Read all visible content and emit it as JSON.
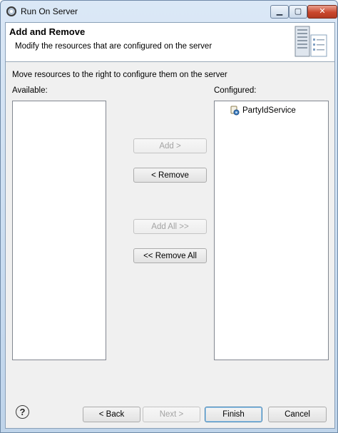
{
  "window": {
    "title": "Run On Server",
    "controls": {
      "minimize": "▁",
      "maximize": "▢",
      "close": "✕"
    }
  },
  "banner": {
    "title": "Add and Remove",
    "description": "Modify the resources that are configured on the server",
    "image_icon": "server-icon"
  },
  "body": {
    "instruction": "Move resources to the right to configure them on the server",
    "available_label": "Available:",
    "configured_label": "Configured:",
    "available_items": [],
    "configured_items": [
      {
        "label": "PartyIdService",
        "icon": "service-module-icon"
      }
    ]
  },
  "transfer_buttons": {
    "add": "Add >",
    "remove": "< Remove",
    "add_all": "Add All >>",
    "remove_all": "<< Remove All"
  },
  "footer": {
    "help": "?",
    "back": "< Back",
    "next": "Next >",
    "finish": "Finish",
    "cancel": "Cancel"
  },
  "colors": {
    "titlebar": "#c9dcf0",
    "close_button": "#c9472d",
    "default_button_border": "#3c7fb1",
    "disabled_text": "#a3a3a3"
  }
}
